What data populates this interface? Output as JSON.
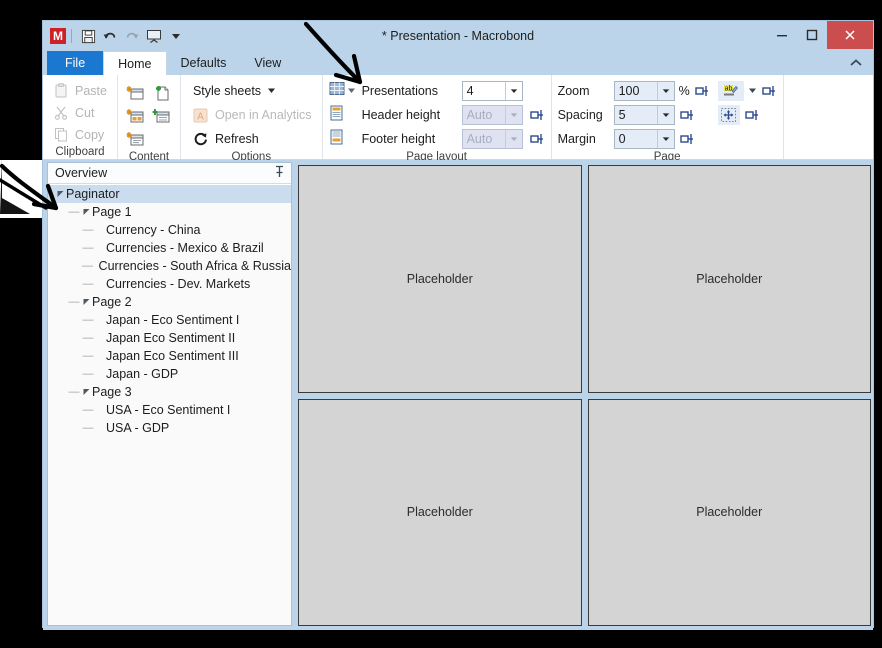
{
  "window": {
    "title": "* Presentation - Macrobond",
    "app_icon": "M",
    "minimize_label": "Minimize",
    "maximize_label": "Maximize",
    "close_label": "Close",
    "close_color": "#cb4d4d",
    "titlebar_color": "#bcd4ea"
  },
  "quick_access": [
    {
      "name": "save-icon",
      "label": "Save"
    },
    {
      "name": "undo-icon",
      "label": "Undo"
    },
    {
      "name": "redo-icon",
      "label": "Redo"
    },
    {
      "name": "presentation-icon",
      "label": "Presentation"
    },
    {
      "name": "customize-qat-icon",
      "label": "Customize Quick Access Toolbar"
    }
  ],
  "tabs": [
    {
      "label": "File",
      "active": false,
      "accent": "#1b78d0"
    },
    {
      "label": "Home",
      "active": true
    },
    {
      "label": "Defaults",
      "active": false
    },
    {
      "label": "View",
      "active": false
    }
  ],
  "ribbon": {
    "collapse_label": "Collapse the Ribbon",
    "groups": {
      "clipboard": {
        "label": "Clipboard",
        "items": [
          {
            "label": "Paste",
            "icon": "paste-icon",
            "disabled": true
          },
          {
            "label": "Cut",
            "icon": "cut-icon",
            "disabled": true
          },
          {
            "label": "Copy",
            "icon": "copy-icon",
            "disabled": true
          }
        ]
      },
      "content": {
        "label": "Content",
        "items": [
          {
            "icon": "new-chart-icon",
            "label": "New chart"
          },
          {
            "icon": "new-document-icon",
            "label": "New document"
          },
          {
            "icon": "new-table-icon",
            "label": "New table"
          },
          {
            "icon": "new-series-list-icon",
            "label": "New series list"
          },
          {
            "icon": "new-text-block-icon",
            "label": "New text block"
          }
        ]
      },
      "options": {
        "label": "Options",
        "items": [
          {
            "label": "Style sheets",
            "icon": "style-sheets-icon",
            "has_dropdown": true,
            "disabled": false
          },
          {
            "label": "Open in Analytics",
            "icon": "analytics-icon",
            "disabled": true
          },
          {
            "label": "Refresh",
            "icon": "refresh-icon",
            "disabled": false
          }
        ]
      },
      "page_layout": {
        "label": "Page layout",
        "grid_icon": "layout-grid-icon",
        "header_icon": "header-page-icon",
        "footer_icon": "footer-page-icon",
        "rows": [
          {
            "label": "Presentations",
            "value": "4",
            "disabled": false,
            "pin": false
          },
          {
            "label": "Header height",
            "value": "Auto",
            "disabled": true,
            "pin": true
          },
          {
            "label": "Footer height",
            "value": "Auto",
            "disabled": true,
            "pin": true
          }
        ]
      },
      "page": {
        "label": "Page",
        "rows": [
          {
            "label": "Zoom",
            "value": "100",
            "suffix": "%",
            "pin": true
          },
          {
            "label": "Spacing",
            "value": "5",
            "suffix": "",
            "pin": true
          },
          {
            "label": "Margin",
            "value": "0",
            "suffix": "",
            "pin": true
          }
        ],
        "extras": [
          {
            "icon": "highlight-color-icon",
            "has_dropdown": true,
            "pin": true,
            "label": "Background color"
          },
          {
            "icon": "fit-to-page-icon",
            "has_dropdown": false,
            "pin": true,
            "label": "Fit to page"
          }
        ]
      }
    }
  },
  "overview": {
    "title": "Overview",
    "pin_icon": "pin-icon",
    "tree": [
      {
        "label": "Paginator",
        "level": 1,
        "expander": "expanded",
        "selected": true
      },
      {
        "label": "Page 1",
        "level": 2,
        "expander": "expanded",
        "selected": false
      },
      {
        "label": "Currency - China",
        "level": 3,
        "expander": "none",
        "selected": false
      },
      {
        "label": "Currencies - Mexico & Brazil",
        "level": 3,
        "expander": "none",
        "selected": false
      },
      {
        "label": "Currencies - South Africa & Russia",
        "level": 3,
        "expander": "none",
        "selected": false
      },
      {
        "label": "Currencies - Dev. Markets",
        "level": 3,
        "expander": "none",
        "selected": false
      },
      {
        "label": "Page 2",
        "level": 2,
        "expander": "expanded",
        "selected": false
      },
      {
        "label": "Japan - Eco Sentiment I",
        "level": 3,
        "expander": "none",
        "selected": false
      },
      {
        "label": "Japan Eco Sentiment II",
        "level": 3,
        "expander": "none",
        "selected": false
      },
      {
        "label": "Japan Eco Sentiment III",
        "level": 3,
        "expander": "none",
        "selected": false
      },
      {
        "label": "Japan - GDP",
        "level": 3,
        "expander": "none",
        "selected": false
      },
      {
        "label": "Page 3",
        "level": 2,
        "expander": "expanded",
        "selected": false
      },
      {
        "label": "USA - Eco Sentiment I",
        "level": 3,
        "expander": "none",
        "selected": false
      },
      {
        "label": "USA - GDP",
        "level": 3,
        "expander": "none",
        "selected": false
      }
    ]
  },
  "canvas": {
    "placeholders": [
      {
        "label": "Placeholder"
      },
      {
        "label": "Placeholder"
      },
      {
        "label": "Placeholder"
      },
      {
        "label": "Placeholder"
      }
    ],
    "placeholder_color": "#d4d4d4"
  },
  "annotations": [
    {
      "name": "arrow-pointing-to-layout-grid",
      "kind": "hand-drawn-arrow"
    },
    {
      "name": "arrow-pointing-to-overview-tree",
      "kind": "hand-drawn-arrow"
    }
  ]
}
